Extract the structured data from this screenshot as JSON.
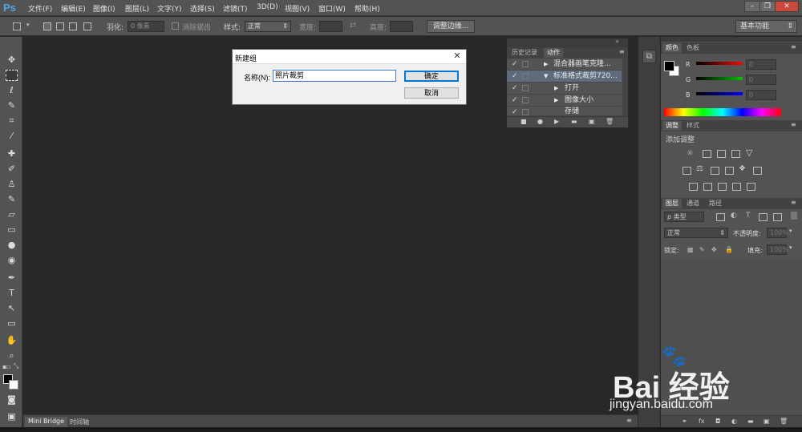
{
  "app": {
    "logo": "Ps"
  },
  "menu": [
    "文件(F)",
    "编辑(E)",
    "图像(I)",
    "图层(L)",
    "文字(Y)",
    "选择(S)",
    "滤镜(T)",
    "3D(D)",
    "视图(V)",
    "窗口(W)",
    "帮助(H)"
  ],
  "window_buttons": [
    "–",
    "❐",
    "✕"
  ],
  "options": {
    "feather_label": "羽化:",
    "feather_value": "0 像素",
    "antialias_label": "消除锯齿",
    "style_label": "样式:",
    "style_value": "正常",
    "width_label": "宽度:",
    "height_label": "高度:",
    "refine_edge": "调整边缘...",
    "workspace": "基本功能"
  },
  "dialog": {
    "title": "新建组",
    "close": "✕",
    "name_label": "名称(N):",
    "name_value": "照片裁剪",
    "ok": "确定",
    "cancel": "取消"
  },
  "actions_panel": {
    "tabs": [
      "历史记录",
      "动作"
    ],
    "rows": [
      {
        "check": "✓",
        "arrow": "▶",
        "label": "混合器画笔克隆..."
      },
      {
        "check": "✓",
        "arrow": "▼",
        "label": "标准格式裁剪720..."
      },
      {
        "check": "✓",
        "arrow": "▶",
        "label": "打开"
      },
      {
        "check": "✓",
        "arrow": "▶",
        "label": "图像大小"
      },
      {
        "check": "✓",
        "arrow": "",
        "label": "存储"
      }
    ]
  },
  "color_panel": {
    "tabs": [
      "颜色",
      "色板"
    ],
    "channels": [
      {
        "label": "R",
        "value": "0",
        "color": "#ff0000"
      },
      {
        "label": "G",
        "value": "0",
        "color": "#00c000"
      },
      {
        "label": "B",
        "value": "0",
        "color": "#0000ff"
      }
    ]
  },
  "adjust_panel": {
    "tabs": [
      "调整",
      "样式"
    ],
    "heading": "添加调整"
  },
  "layers_panel": {
    "tabs": [
      "图层",
      "通道",
      "路径"
    ],
    "filter_kind": "ρ 类型",
    "blend_mode": "正常",
    "opacity_label": "不透明度:",
    "opacity_value": "100%",
    "lock_label": "锁定:",
    "fill_label": "填充:",
    "fill_value": "100%"
  },
  "bottom_tabs": [
    "Mini Bridge",
    "时间轴"
  ],
  "watermark": {
    "logo": "Bai 经验",
    "url": "jingyan.baidu.com"
  }
}
